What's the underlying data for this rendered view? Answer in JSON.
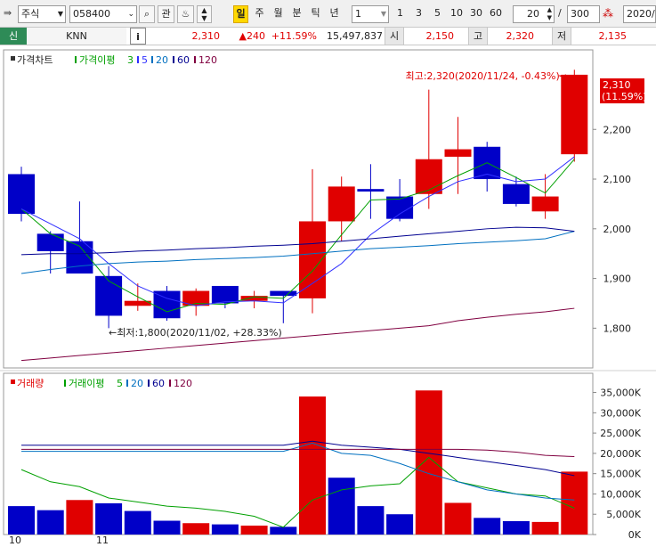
{
  "toolbar": {
    "market": "주식",
    "code": "058400",
    "btn_gwan": "관",
    "period_active": "일",
    "periods": [
      "주",
      "월",
      "분",
      "틱",
      "년"
    ],
    "interval": "1",
    "ticks": [
      "1",
      "3",
      "5",
      "10",
      "30",
      "60"
    ],
    "count": "20",
    "slash": "/",
    "total": "300",
    "date": "2020/"
  },
  "quote": {
    "badge": "신",
    "name": "KNN",
    "info": "i",
    "price": "2,310",
    "change": "▲240",
    "change_pct": "+11.59%",
    "volume": "15,497,837",
    "open_label": "시",
    "open": "2,150",
    "high_label": "고",
    "high": "2,320",
    "low_label": "저",
    "low": "2,135"
  },
  "price_panel": {
    "legend": [
      "가격차트",
      "가격이평",
      "3",
      "5",
      "20",
      "60",
      "120"
    ],
    "max_annotation": "최고:2,320(2020/11/24, -0.43%)→",
    "min_annotation": "←최저:1,800(2020/11/02, +28.33%)",
    "current_price_label": "2,310",
    "current_pct_label": "(11.59%)"
  },
  "volume_panel": {
    "legend": [
      "거래량",
      "거래이평",
      "5",
      "20",
      "60",
      "120"
    ]
  },
  "x_labels": [
    "10",
    "11"
  ],
  "colors": {
    "up": "#e00000",
    "down": "#0000c8",
    "ma3": "#00a000",
    "ma5": "#3030ff",
    "ma20": "#0070c0",
    "ma60": "#000090",
    "ma120": "#800040"
  },
  "chart_data": [
    {
      "type": "candlestick",
      "ylim": [
        1720,
        2360
      ],
      "yticks": [
        "1,800",
        "1,900",
        "2,000",
        "2,100",
        "2,200"
      ],
      "candles": [
        {
          "o": 2110,
          "h": 2125,
          "l": 2015,
          "c": 2030
        },
        {
          "o": 1990,
          "h": 1995,
          "l": 1910,
          "c": 1955
        },
        {
          "o": 1975,
          "h": 2055,
          "l": 1910,
          "c": 1910
        },
        {
          "o": 1905,
          "h": 1925,
          "l": 1800,
          "c": 1825
        },
        {
          "o": 1845,
          "h": 1890,
          "l": 1835,
          "c": 1855
        },
        {
          "o": 1875,
          "h": 1885,
          "l": 1815,
          "c": 1820
        },
        {
          "o": 1845,
          "h": 1880,
          "l": 1825,
          "c": 1875
        },
        {
          "o": 1885,
          "h": 1885,
          "l": 1840,
          "c": 1850
        },
        {
          "o": 1855,
          "h": 1875,
          "l": 1840,
          "c": 1865
        },
        {
          "o": 1875,
          "h": 1875,
          "l": 1810,
          "c": 1865
        },
        {
          "o": 1860,
          "h": 2120,
          "l": 1830,
          "c": 2015
        },
        {
          "o": 2015,
          "h": 2105,
          "l": 1975,
          "c": 2085
        },
        {
          "o": 2080,
          "h": 2130,
          "l": 2020,
          "c": 2075
        },
        {
          "o": 2065,
          "h": 2100,
          "l": 2015,
          "c": 2020
        },
        {
          "o": 2070,
          "h": 2280,
          "l": 2040,
          "c": 2140
        },
        {
          "o": 2145,
          "h": 2225,
          "l": 2070,
          "c": 2160
        },
        {
          "o": 2165,
          "h": 2175,
          "l": 2075,
          "c": 2100
        },
        {
          "o": 2090,
          "h": 2105,
          "l": 2045,
          "c": 2050
        },
        {
          "o": 2035,
          "h": 2110,
          "l": 2020,
          "c": 2065
        },
        {
          "o": 2150,
          "h": 2320,
          "l": 2135,
          "c": 2310
        }
      ],
      "series": [
        {
          "name": "3",
          "values": [
            2040,
            1990,
            1965,
            1895,
            1863,
            1833,
            1850,
            1848,
            1863,
            1860,
            1915,
            1988,
            2058,
            2060,
            2078,
            2107,
            2133,
            2103,
            2072,
            2140
          ]
        },
        {
          "name": "5",
          "values": [
            2040,
            2010,
            1980,
            1930,
            1885,
            1860,
            1845,
            1853,
            1855,
            1851,
            1890,
            1930,
            1988,
            2030,
            2065,
            2095,
            2110,
            2095,
            2100,
            2145
          ]
        },
        {
          "name": "20",
          "values": [
            1910,
            1918,
            1925,
            1930,
            1933,
            1935,
            1938,
            1940,
            1942,
            1945,
            1950,
            1955,
            1960,
            1963,
            1966,
            1970,
            1973,
            1976,
            1980,
            1995
          ]
        },
        {
          "name": "60",
          "values": [
            1948,
            1950,
            1950,
            1952,
            1955,
            1957,
            1960,
            1962,
            1965,
            1967,
            1970,
            1975,
            1980,
            1985,
            1990,
            1995,
            2000,
            2003,
            2002,
            1995
          ]
        },
        {
          "name": "120",
          "values": [
            1735,
            1740,
            1745,
            1750,
            1755,
            1760,
            1765,
            1770,
            1775,
            1780,
            1785,
            1790,
            1795,
            1800,
            1805,
            1815,
            1822,
            1828,
            1833,
            1840
          ]
        }
      ]
    },
    {
      "type": "bar",
      "ylim": [
        0,
        36000
      ],
      "yticks": [
        "0K",
        "5,000K",
        "10,000K",
        "15,000K",
        "20,000K",
        "25,000K",
        "30,000K",
        "35,000K"
      ],
      "values": [
        7000,
        6000,
        8500,
        7700,
        5800,
        3400,
        2800,
        2500,
        2200,
        1900,
        34000,
        14000,
        7000,
        5000,
        35500,
        7800,
        4100,
        3300,
        3100,
        15500
      ],
      "up": [
        false,
        false,
        true,
        false,
        false,
        false,
        true,
        false,
        true,
        false,
        true,
        false,
        false,
        false,
        true,
        true,
        false,
        false,
        true,
        true
      ],
      "series": [
        {
          "name": "5",
          "values": [
            16000,
            13000,
            11800,
            9000,
            8000,
            7000,
            6500,
            5700,
            4500,
            1800,
            8500,
            11000,
            12000,
            12500,
            19000,
            13000,
            11500,
            10000,
            9500,
            6500
          ]
        },
        {
          "name": "20",
          "values": [
            20500,
            20500,
            20500,
            20500,
            20500,
            20500,
            20500,
            20500,
            20500,
            20500,
            22500,
            20000,
            19500,
            17500,
            15000,
            13000,
            11000,
            10000,
            9000,
            8500
          ]
        },
        {
          "name": "60",
          "values": [
            22000,
            22000,
            22000,
            22000,
            22000,
            22000,
            22000,
            22000,
            22000,
            22000,
            23000,
            22000,
            21500,
            21000,
            20000,
            19000,
            18000,
            17000,
            16000,
            14500
          ]
        },
        {
          "name": "120",
          "values": [
            21000,
            21000,
            21000,
            21000,
            21000,
            21000,
            21000,
            21000,
            21000,
            21000,
            21000,
            21000,
            21000,
            21000,
            21000,
            21000,
            20800,
            20300,
            19500,
            19200
          ]
        }
      ]
    }
  ]
}
